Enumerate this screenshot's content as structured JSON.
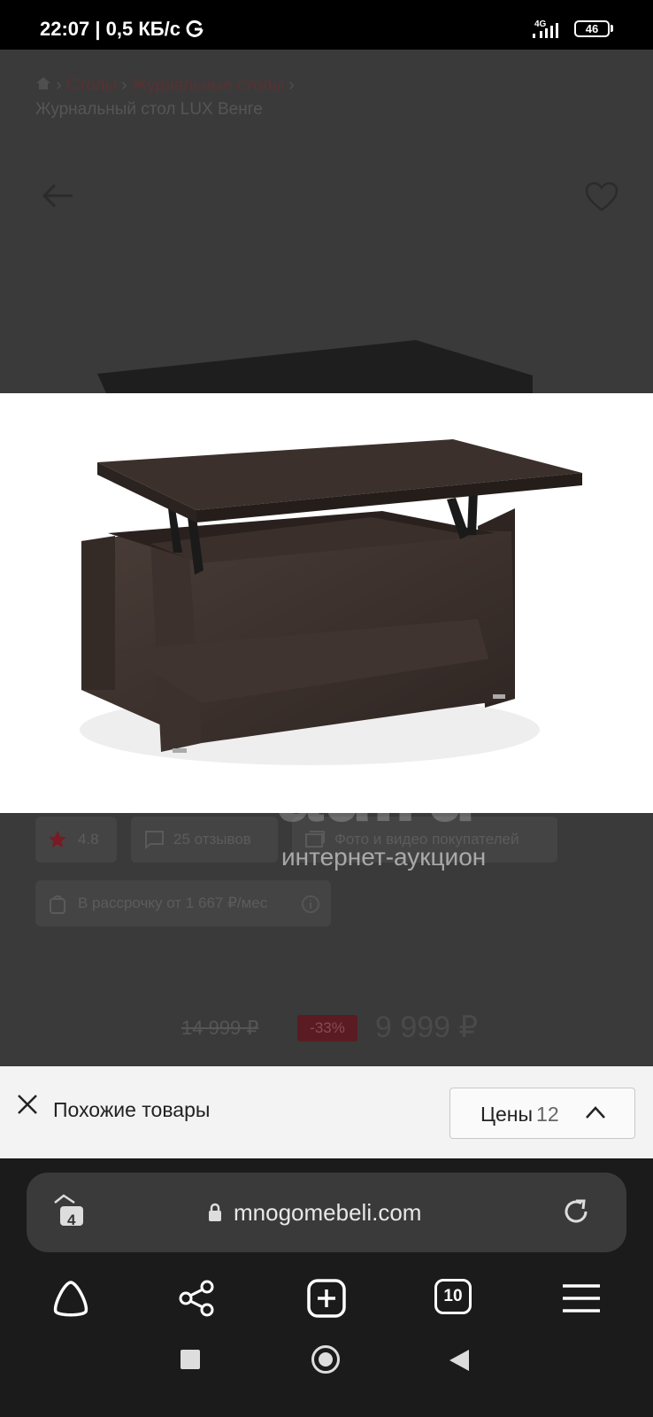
{
  "status_bar": {
    "time": "22:07 | 0,5 КБ/с",
    "network": "4G",
    "battery": "46"
  },
  "page": {
    "breadcrumb": [
      "Столы",
      "Журнальные столы"
    ],
    "title": "Журнальный стол LUX Венге",
    "rating": "4.8",
    "reviews": "25 отзывов",
    "photos": "Фото и видео покупателей",
    "installment": "В рассрочку от 1 667 ₽/мес",
    "old_price": "14 999 ₽",
    "discount": "-33%",
    "price": "9 999 ₽"
  },
  "watermark": {
    "logo": "au.ru",
    "subtitle": "интернет-аукцион"
  },
  "similar": {
    "title": "Похожие товары",
    "prices_label": "Цены",
    "prices_count": "12"
  },
  "browser": {
    "url": "mnogomebeli.com",
    "tab_badge": "4",
    "tabs_count": "10"
  },
  "colors": {
    "accent_red": "#d0202e",
    "wenge": "#3b302c"
  }
}
